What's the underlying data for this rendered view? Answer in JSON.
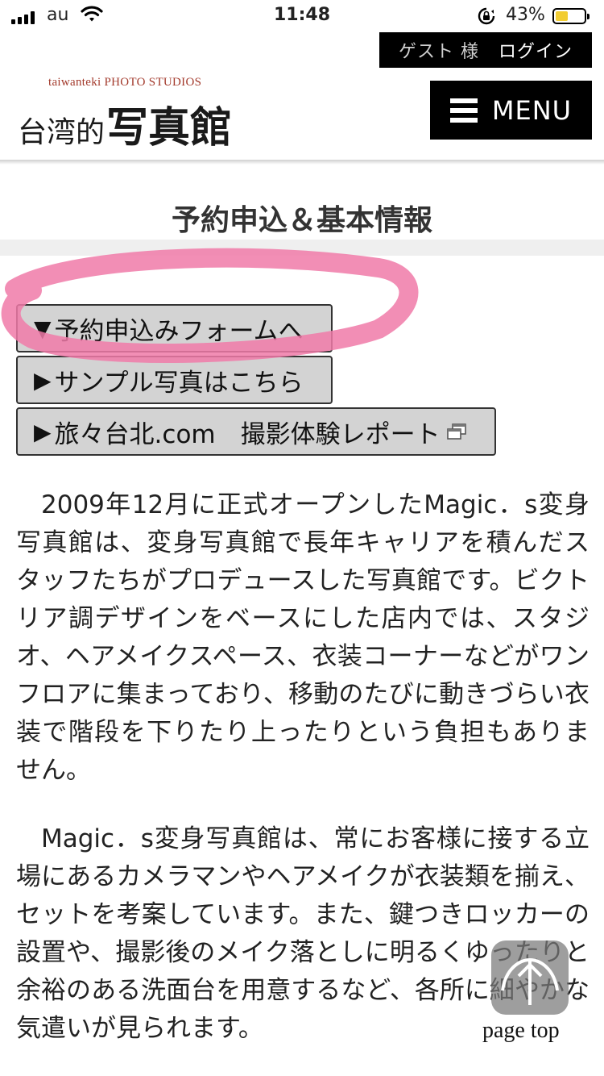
{
  "status_bar": {
    "carrier": "au",
    "time": "11:48",
    "battery_percent": "43%",
    "battery_level": 0.43,
    "battery_color": "#f2cd33"
  },
  "header": {
    "guest_label": "ゲスト 様",
    "login_label": "ログイン",
    "logo_subtitle": "taiwanteki PHOTO STUDIOS",
    "logo_text_small": "台湾的",
    "logo_text_large": "写真館",
    "menu_label": "MENU"
  },
  "page": {
    "title": "予約申込＆基本情報"
  },
  "links": [
    {
      "arrow": "▼",
      "label": "予約申込みフォームへ",
      "icon": "arrow-down-icon"
    },
    {
      "arrow": "▶",
      "label": "サンプル写真はこちら",
      "icon": "arrow-right-icon"
    },
    {
      "arrow": "▶",
      "label": "旅々台北.com　撮影体験レポート",
      "icon": "external-link-icon"
    }
  ],
  "paragraphs": [
    "2009年12月に正式オープンしたMagic．s変身写真館は、変身写真館で長年キャリアを積んだスタッフたちがプロデュースした写真館です。ビクトリア調デザインをベースにした店内では、スタジオ、ヘアメイクスペース、衣装コーナーなどがワンフロアに集まっており、移動のたびに動きづらい衣装で階段を下りたり上ったりという負担もありません。",
    "Magic．s変身写真館は、常にお客様に接する立場にあるカメラマンやヘアメイクが衣装類を揃え、セットを考案しています。また、鍵つきロッカーの設置や、撮影後のメイク落としに明るくゆったりと余裕のある洗面台を用意するなど、各所に細やかな気遣いが見られます。"
  ],
  "page_top": {
    "label": "page top"
  },
  "colors": {
    "highlight_ring": "#f07aa8",
    "logo_accent": "#a33a2c",
    "button_bg": "#d3d3d3"
  }
}
